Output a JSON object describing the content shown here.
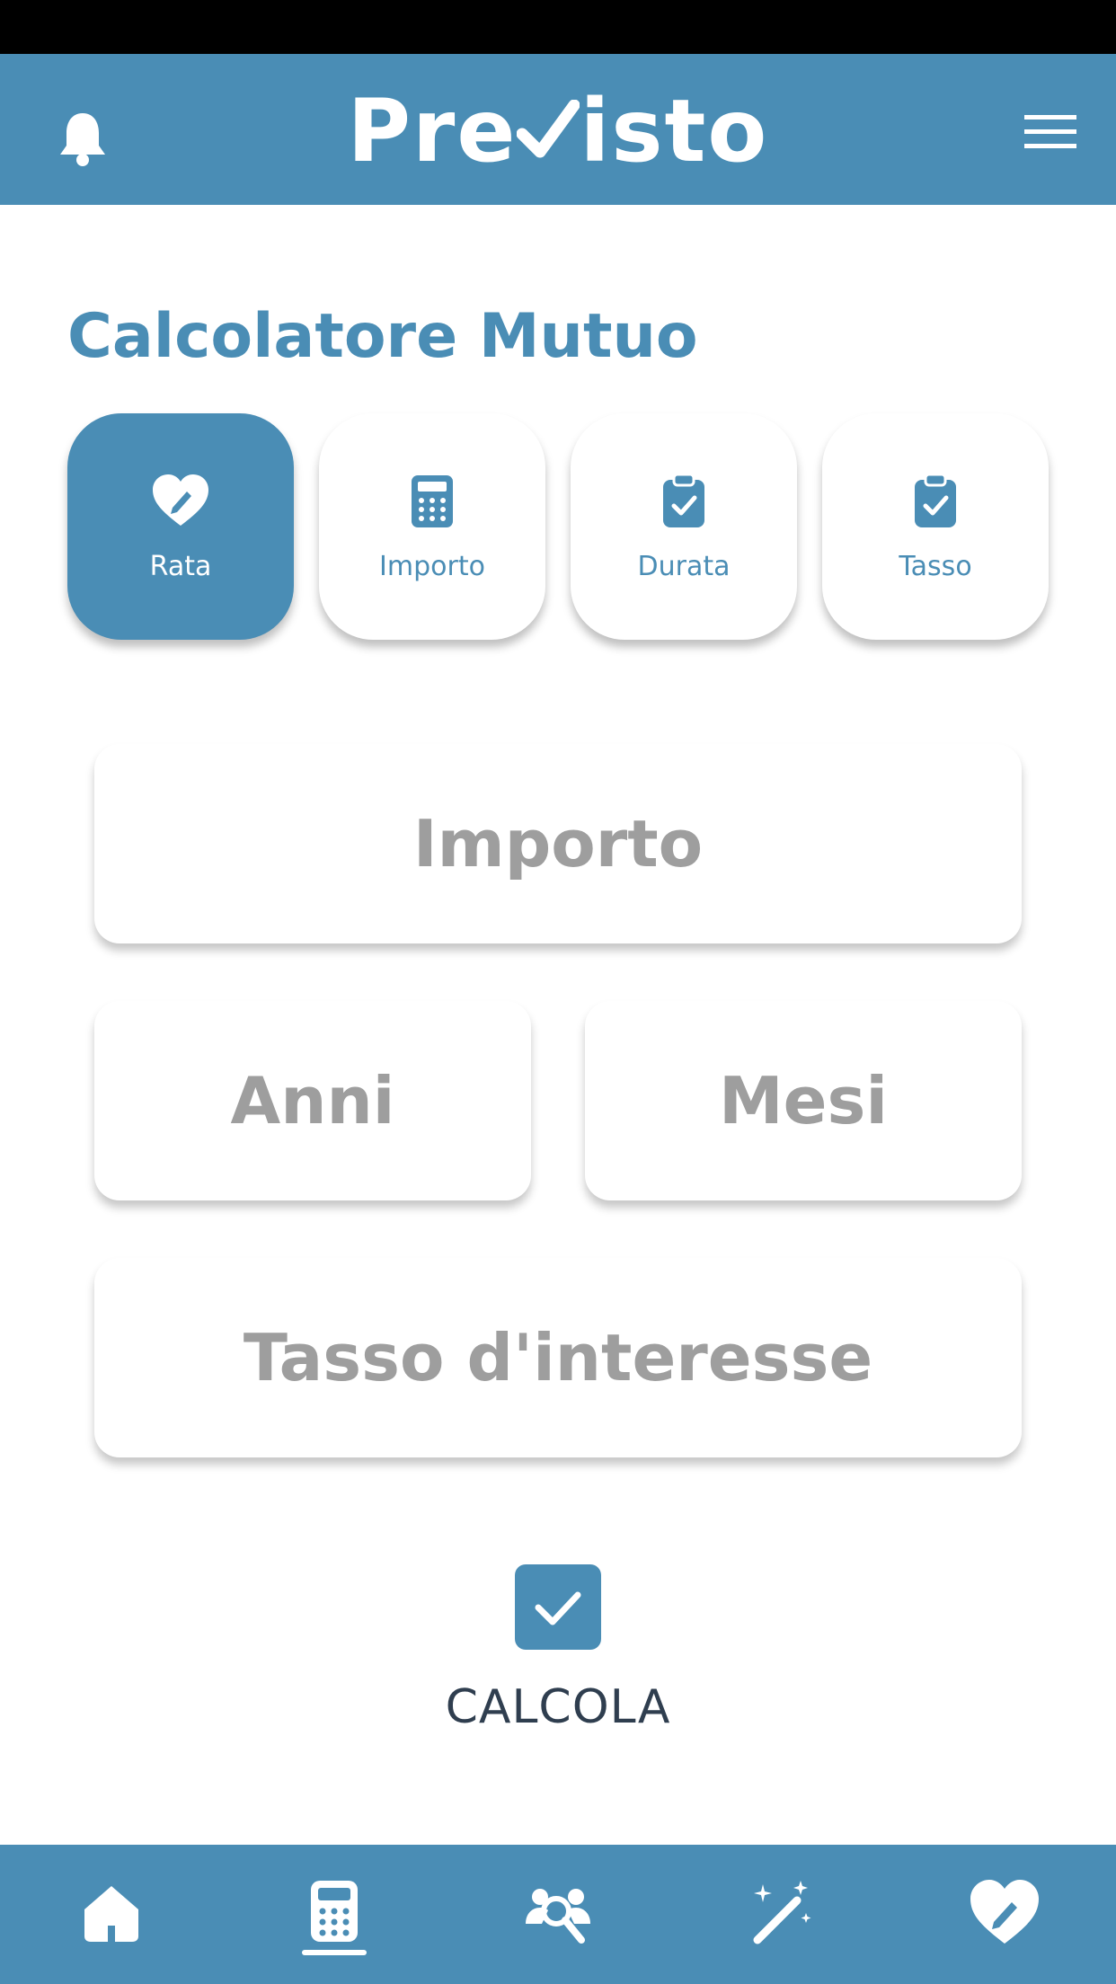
{
  "header": {
    "logo": "Previsto",
    "logo_before_check": "Pre",
    "logo_after_check": "isto"
  },
  "page": {
    "title": "Calcolatore Mutuo"
  },
  "mode_tabs": [
    {
      "label": "Rata",
      "icon": "heart-pencil-icon",
      "active": true
    },
    {
      "label": "Importo",
      "icon": "calculator-icon",
      "active": false
    },
    {
      "label": "Durata",
      "icon": "clipboard-check-icon",
      "active": false
    },
    {
      "label": "Tasso",
      "icon": "clipboard-check-icon",
      "active": false
    }
  ],
  "form": {
    "importo_placeholder": "Importo",
    "anni_placeholder": "Anni",
    "mesi_placeholder": "Mesi",
    "tasso_placeholder": "Tasso d'interesse"
  },
  "calculate": {
    "label": "CALCOLA",
    "icon": "checkbox-check-icon"
  },
  "bottom_nav": [
    {
      "icon": "home-icon",
      "active": false
    },
    {
      "icon": "calculator-icon",
      "active": true
    },
    {
      "icon": "users-search-icon",
      "active": false
    },
    {
      "icon": "magic-wand-icon",
      "active": false
    },
    {
      "icon": "heart-pencil-icon",
      "active": false
    }
  ],
  "colors": {
    "primary": "#4a8db5",
    "placeholder": "#9e9e9e",
    "label_dark": "#2f3e4f"
  }
}
